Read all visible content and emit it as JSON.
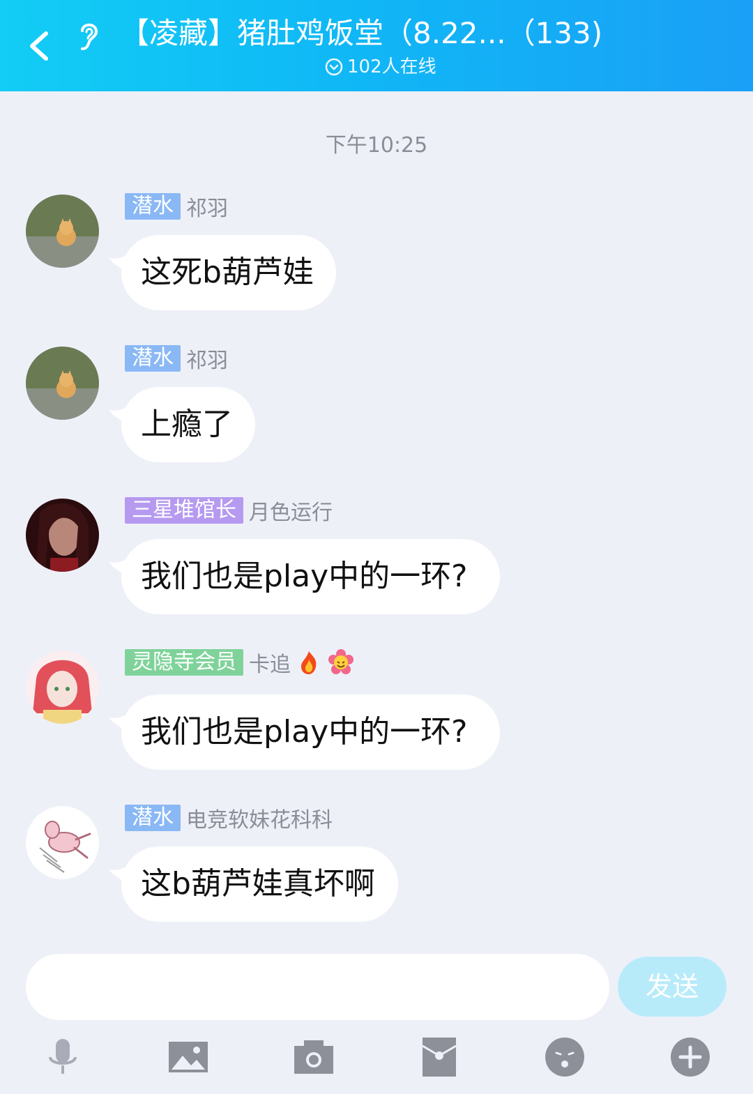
{
  "header": {
    "title": "【凌藏】猪肚鸡饭堂（8.22...（133)",
    "online_text": "102人在线",
    "back_icon": "back-icon",
    "ear_icon": "ear-icon"
  },
  "chat": {
    "timestamp": "下午10:25",
    "messages": [
      {
        "badge": "潜水",
        "badge_color": "#8ab8f5",
        "nick": "祁羽",
        "text": "这死b葫芦娃"
      },
      {
        "badge": "潜水",
        "badge_color": "#8ab8f5",
        "nick": "祁羽",
        "text": "上瘾了"
      },
      {
        "badge": "三星堆馆长",
        "badge_color": "#b59af0",
        "nick": "月色运行",
        "text": "我们也是play中的一环?"
      },
      {
        "badge": "灵隐寺会员",
        "badge_color": "#7fd39a",
        "nick": "卡追",
        "text": "我们也是play中的一环?"
      },
      {
        "badge": "潜水",
        "badge_color": "#8ab8f5",
        "nick": "电竞软妹花科科",
        "text": "这b葫芦娃真坏啊"
      }
    ]
  },
  "input": {
    "value": "",
    "send_label": "发送"
  },
  "toolbar": {
    "icons": [
      "microphone-icon",
      "image-icon",
      "camera-icon",
      "red-envelope-icon",
      "emoji-icon",
      "plus-icon"
    ]
  },
  "colors": {
    "header_start": "#12cdf5",
    "header_end": "#1aa0f6",
    "background": "#eef0f8",
    "send_button": "#b8ebfa"
  }
}
